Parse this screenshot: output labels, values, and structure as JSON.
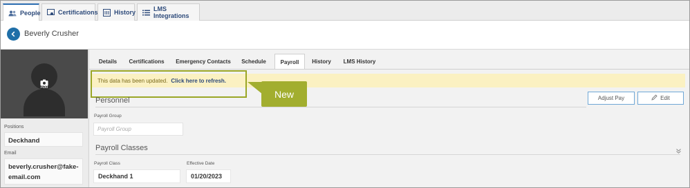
{
  "top_tabs": [
    {
      "label": "People",
      "icon": "people-icon",
      "active": true
    },
    {
      "label": "Certifications",
      "icon": "certificate-icon",
      "active": false
    },
    {
      "label": "History",
      "icon": "history-icon",
      "active": false
    },
    {
      "label": "LMS Integrations",
      "icon": "list-icon",
      "active": false
    }
  ],
  "person": {
    "name": "Beverly Crusher"
  },
  "photo": {
    "add_label": "Add"
  },
  "sidebar": {
    "positions_label": "Positions",
    "positions_value": "Deckhand",
    "email_label": "Email",
    "email_line1": "beverly.crusher@fake-",
    "email_line2": "email.com"
  },
  "sub_tabs": [
    {
      "label": "Details",
      "active": false
    },
    {
      "label": "Certifications",
      "active": false
    },
    {
      "label": "Emergency Contacts",
      "active": false
    },
    {
      "label": "Schedule",
      "active": false
    },
    {
      "label": "Payroll",
      "active": true
    },
    {
      "label": "History",
      "active": false
    },
    {
      "label": "LMS History",
      "active": false
    }
  ],
  "notice": {
    "text": "This data has been updated.",
    "link": "Click here to refresh."
  },
  "callout": {
    "label": "New"
  },
  "personnel": {
    "title": "Personnel",
    "adjust_pay_label": "Adjust Pay",
    "edit_label": "Edit",
    "payroll_group_label": "Payroll Group",
    "payroll_group_placeholder": "Payroll Group"
  },
  "payroll_classes": {
    "title": "Payroll Classes",
    "class_label": "Payroll Class",
    "class_value": "Deckhand 1",
    "date_label": "Effective Date",
    "date_value": "01/20/2023"
  },
  "colors": {
    "accent": "#1f6fa8",
    "highlight": "#9aa625",
    "notice_bg": "#fbf1c2"
  }
}
